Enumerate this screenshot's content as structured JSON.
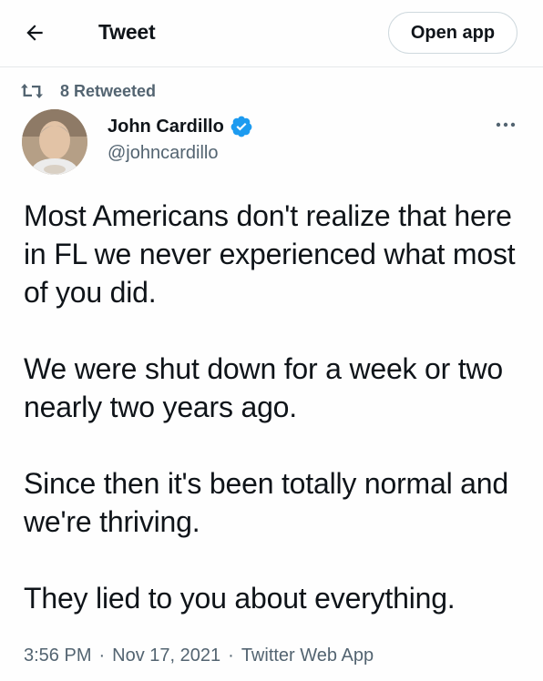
{
  "header": {
    "title": "Tweet",
    "open_app_label": "Open app",
    "back_icon": "arrow-left-icon"
  },
  "retweet": {
    "icon": "retweet-icon",
    "label": "8 Retweeted"
  },
  "author": {
    "name": "John Cardillo",
    "handle": "@johncardillo",
    "verified": true,
    "verified_color": "#1d9bf0"
  },
  "tweet": {
    "paragraphs": [
      "Most Americans don't realize that here in FL we never experienced what most of you did.",
      "We were shut down for a week or two nearly two years ago.",
      "Since then it's been totally normal and we're thriving.",
      "They lied to you about everything."
    ]
  },
  "meta": {
    "time": "3:56 PM",
    "date": "Nov 17, 2021",
    "separator": "·",
    "source": "Twitter Web App"
  },
  "colors": {
    "text_primary": "#0f1419",
    "text_secondary": "#536471",
    "border": "#cfd9de"
  }
}
